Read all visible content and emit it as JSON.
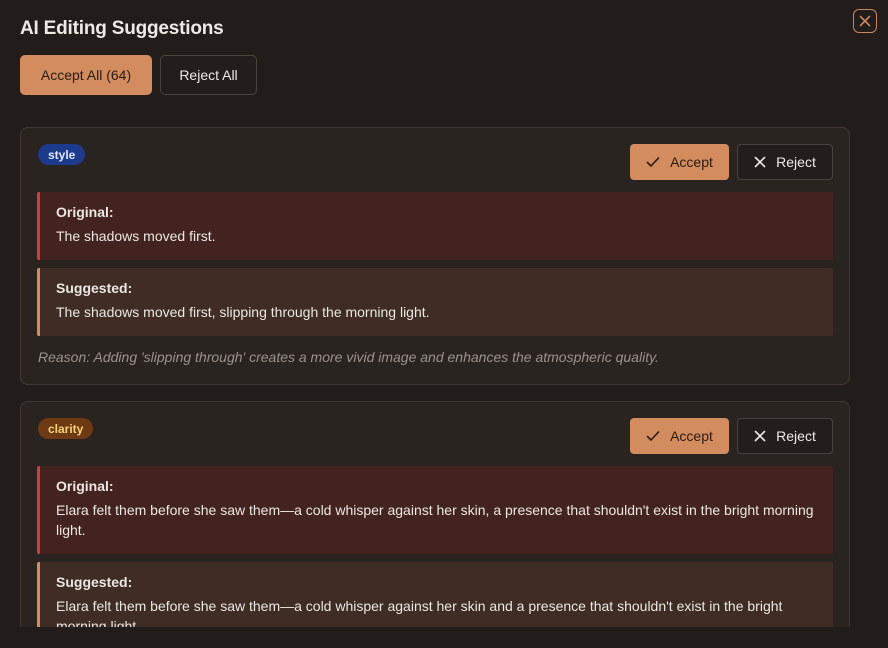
{
  "dialog": {
    "title": "AI Editing Suggestions",
    "accept_all_label": "Accept All (64)",
    "reject_all_label": "Reject All",
    "close_icon": "close-icon"
  },
  "suggestions": [
    {
      "category": "style",
      "accept_label": "Accept",
      "reject_label": "Reject",
      "original_label": "Original:",
      "original_text": "The shadows moved first.",
      "suggested_label": "Suggested:",
      "suggested_text": "The shadows moved first, slipping through the morning light.",
      "reason": "Reason: Adding 'slipping through' creates a more vivid image and enhances the atmospheric quality."
    },
    {
      "category": "clarity",
      "accept_label": "Accept",
      "reject_label": "Reject",
      "original_label": "Original:",
      "original_text": "Elara felt them before she saw them—a cold whisper against her skin, a presence that shouldn't exist in the bright morning light.",
      "suggested_label": "Suggested:",
      "suggested_text": "Elara felt them before she saw them—a cold whisper against her skin and a presence that shouldn't exist in the bright morning light."
    }
  ],
  "colors": {
    "background": "#221d1a",
    "accent": "#d38c5e",
    "original_border": "#d63a3a",
    "style_badge": "#1c3b8c",
    "clarity_badge": "#6e3a14"
  }
}
